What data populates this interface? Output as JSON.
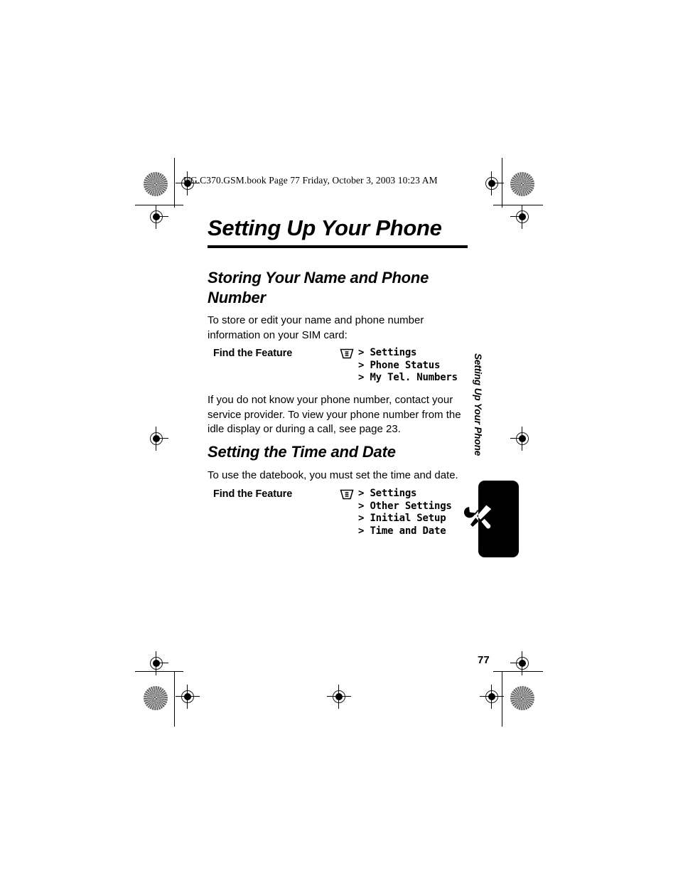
{
  "document": {
    "header_line": "UG.C370.GSM.book  Page 77  Friday, October 3, 2003  10:23 AM",
    "chapter_title": "Setting Up Your Phone",
    "page_number": "77",
    "side_tab_label": "Setting Up Your Phone",
    "tab_icon_name": "wrench-screwdriver-icon"
  },
  "sections": {
    "storing": {
      "heading": "Storing Your Name and Phone Number",
      "intro": "To store or edit your name and phone number information on your SIM card:",
      "find_the_feature_label": "Find the Feature",
      "menu_icon_name": "menu-key-icon",
      "menu_path": [
        "> Settings",
        "> Phone Status",
        "> My Tel. Numbers"
      ],
      "note": "If you do not know your phone number, contact your service provider. To view your phone number from the idle display or during a call, see page 23."
    },
    "time_and_date": {
      "heading": "Setting the Time and Date",
      "intro": "To use the datebook, you must set the time and date.",
      "find_the_feature_label": "Find the Feature",
      "menu_icon_name": "menu-key-icon",
      "menu_path": [
        "> Settings",
        "> Other Settings",
        "> Initial Setup",
        "> Time and Date"
      ]
    }
  },
  "colors": {
    "ink": "#000000",
    "paper": "#ffffff",
    "halftone": "#8f8f8f"
  }
}
